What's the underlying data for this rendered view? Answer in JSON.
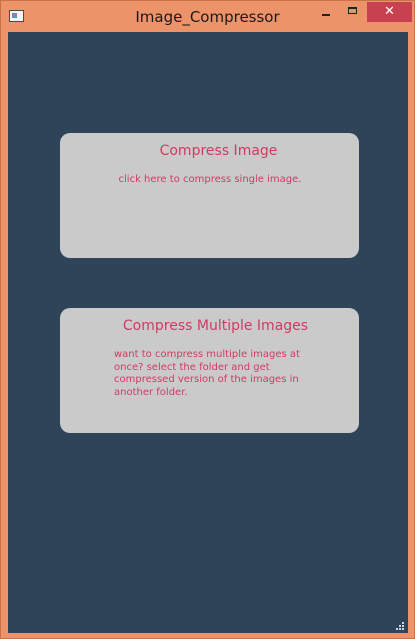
{
  "window": {
    "title": "Image_Compressor",
    "controls": {
      "minimize": "minimize-icon",
      "maximize": "maximize-icon",
      "close": "close-icon"
    }
  },
  "cards": [
    {
      "title": "Compress Image",
      "description": "click here to compress single image."
    },
    {
      "title": "Compress Multiple Images",
      "description_lines": [
        "want to compress multiple images at",
        "once? select the folder and get",
        "compressed version of the images in",
        "another folder."
      ]
    }
  ],
  "colors": {
    "frame": "#ec9369",
    "background": "#2f4458",
    "card": "#cacaca",
    "accent_text": "#d13a63",
    "close_button": "#c74150"
  }
}
